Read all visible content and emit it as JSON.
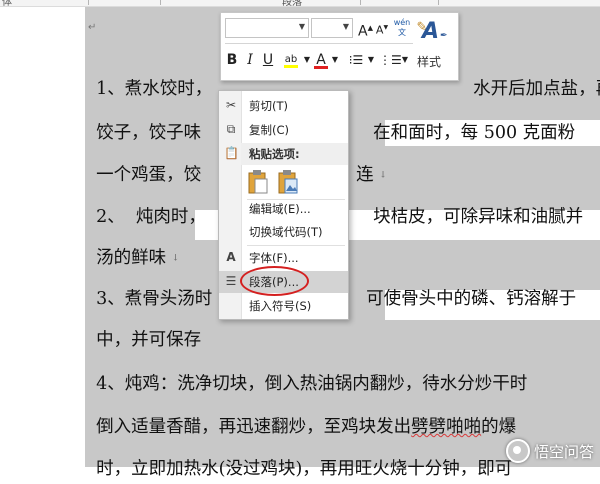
{
  "ruler": {
    "left_text": "体",
    "center_text": "段落"
  },
  "document": {
    "lines": [
      "1、煮水饺时，",
      "饺子，饺子味",
      "一个鸡蛋，饺",
      "2、  炖肉时，",
      "汤的鲜味",
      "3、煮骨头汤时",
      "中，并可保存",
      "4、炖鸡：洗净切块，倒入热油锅内翻炒，待水分炒干时",
      "倒入适量香醋，再迅速翻炒，至鸡块发出",
      "时，立即加热水(没过鸡块)，再用旺火烧十分钟，即可"
    ],
    "right_fragments": {
      "line1": "水开后加点盐，再",
      "line2": "在和面时，每 500 克面粉",
      "line3": "连",
      "line4": "块桔皮，可除异味和油腻并",
      "line6": "可使骨头中的磷、钙溶解于",
      "line9_wavy": "劈劈啪啪",
      "line9_tail": "的爆"
    },
    "paragraph_mark": "↵",
    "newline_mark": "↓"
  },
  "mini_toolbar": {
    "font_name": "",
    "font_size": "",
    "grow_font": "A",
    "shrink_font": "A",
    "phonetic": "wén文",
    "bold": "B",
    "italic": "I",
    "underline": "U",
    "highlight": "ab",
    "font_color": "A",
    "styles_label": "样式"
  },
  "context_menu": {
    "items": [
      {
        "label": "剪切(T)",
        "icon": "scissors-icon"
      },
      {
        "label": "复制(C)",
        "icon": "copy-icon"
      },
      {
        "label": "粘贴选项:",
        "icon": "clipboard-icon"
      },
      {
        "label": "编辑域(E)...",
        "icon": ""
      },
      {
        "label": "切换域代码(T)",
        "icon": ""
      },
      {
        "label": "字体(F)...",
        "icon": "font-icon"
      },
      {
        "label": "段落(P)...",
        "icon": "paragraph-icon"
      },
      {
        "label": "插入符号(S)",
        "icon": ""
      }
    ]
  },
  "watermark": {
    "text": "悟空问答"
  },
  "colors": {
    "selection": "#c8c8c8",
    "highlight_ring": "#d42020",
    "style_blue": "#2b5797",
    "menu_hover": "#d3d3d3"
  }
}
